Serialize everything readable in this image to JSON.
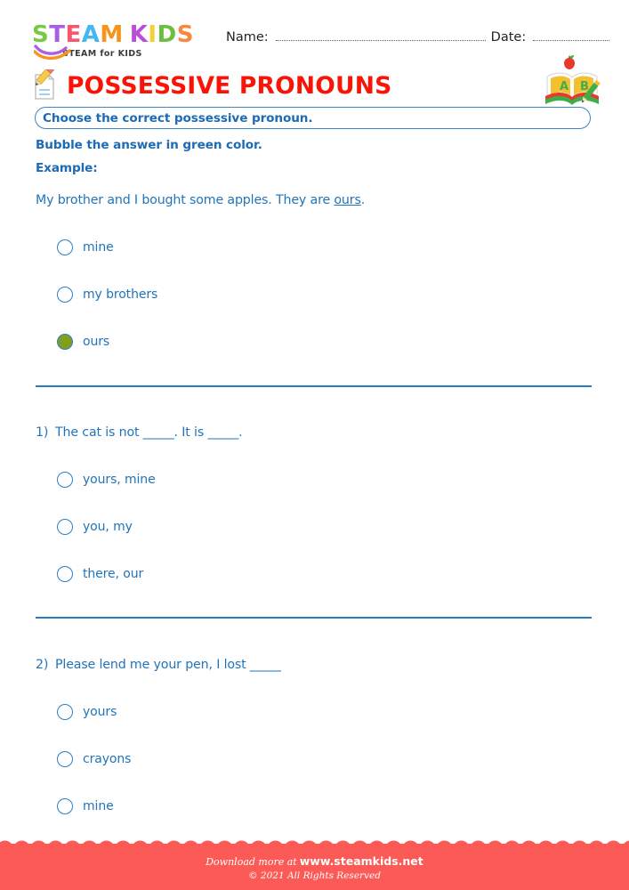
{
  "header": {
    "logo": {
      "letters": [
        {
          "ch": "S",
          "color": "#7ac943"
        },
        {
          "ch": "T",
          "color": "#a95fe0"
        },
        {
          "ch": "E",
          "color": "#f7566e"
        },
        {
          "ch": "A",
          "color": "#45b6ef"
        },
        {
          "ch": "M",
          "color": "#f7941e"
        },
        {
          "ch": "K",
          "color": "#b94fd8"
        },
        {
          "ch": "I",
          "color": "#f5d033"
        },
        {
          "ch": "D",
          "color": "#6cbf3e"
        },
        {
          "ch": "S",
          "color": "#f9883f"
        }
      ],
      "tagline": "STEAM for KIDS"
    },
    "name_label": "Name:",
    "date_label": "Date:"
  },
  "title": {
    "text": "POSSESSIVE PRONOUNS",
    "color": "#fb1405",
    "pencil_icon": "pencil-paper-icon",
    "book_icon": "open-book-apple-pencil-icon"
  },
  "instructions": {
    "boxed": "Choose the correct possessive pronoun.",
    "bubble_note": "Bubble the answer in green color.",
    "example_label": "Example:"
  },
  "example": {
    "sentence_prefix": "My brother and I bought some apples. They are ",
    "sentence_answer": "ours",
    "sentence_suffix": ".",
    "options": [
      {
        "label": "mine",
        "filled": false
      },
      {
        "label": "my brothers",
        "filled": false
      },
      {
        "label": "ours",
        "filled": true
      }
    ]
  },
  "questions": [
    {
      "number": "1)",
      "text": "The cat is not _____. It is _____.",
      "options": [
        {
          "label": "yours, mine",
          "filled": false
        },
        {
          "label": "you, my",
          "filled": false
        },
        {
          "label": "there, our",
          "filled": false
        }
      ]
    },
    {
      "number": "2)",
      "text": "Please lend me your pen, I lost _____",
      "options": [
        {
          "label": "yours",
          "filled": false
        },
        {
          "label": "crayons",
          "filled": false
        },
        {
          "label": "mine",
          "filled": false
        }
      ]
    }
  ],
  "footer": {
    "download_text": "Download more at",
    "site": "www.steamkids.net",
    "copyright": "© 2021 All Rights Reserved",
    "band_color": "#fc5a56"
  },
  "colors": {
    "blue_text": "#2274ba",
    "blue_bold": "#1b6bb5",
    "bubble_border": "#2e7fc4",
    "bubble_fill": "#7f9f1d",
    "divider": "#2a7cbe"
  }
}
